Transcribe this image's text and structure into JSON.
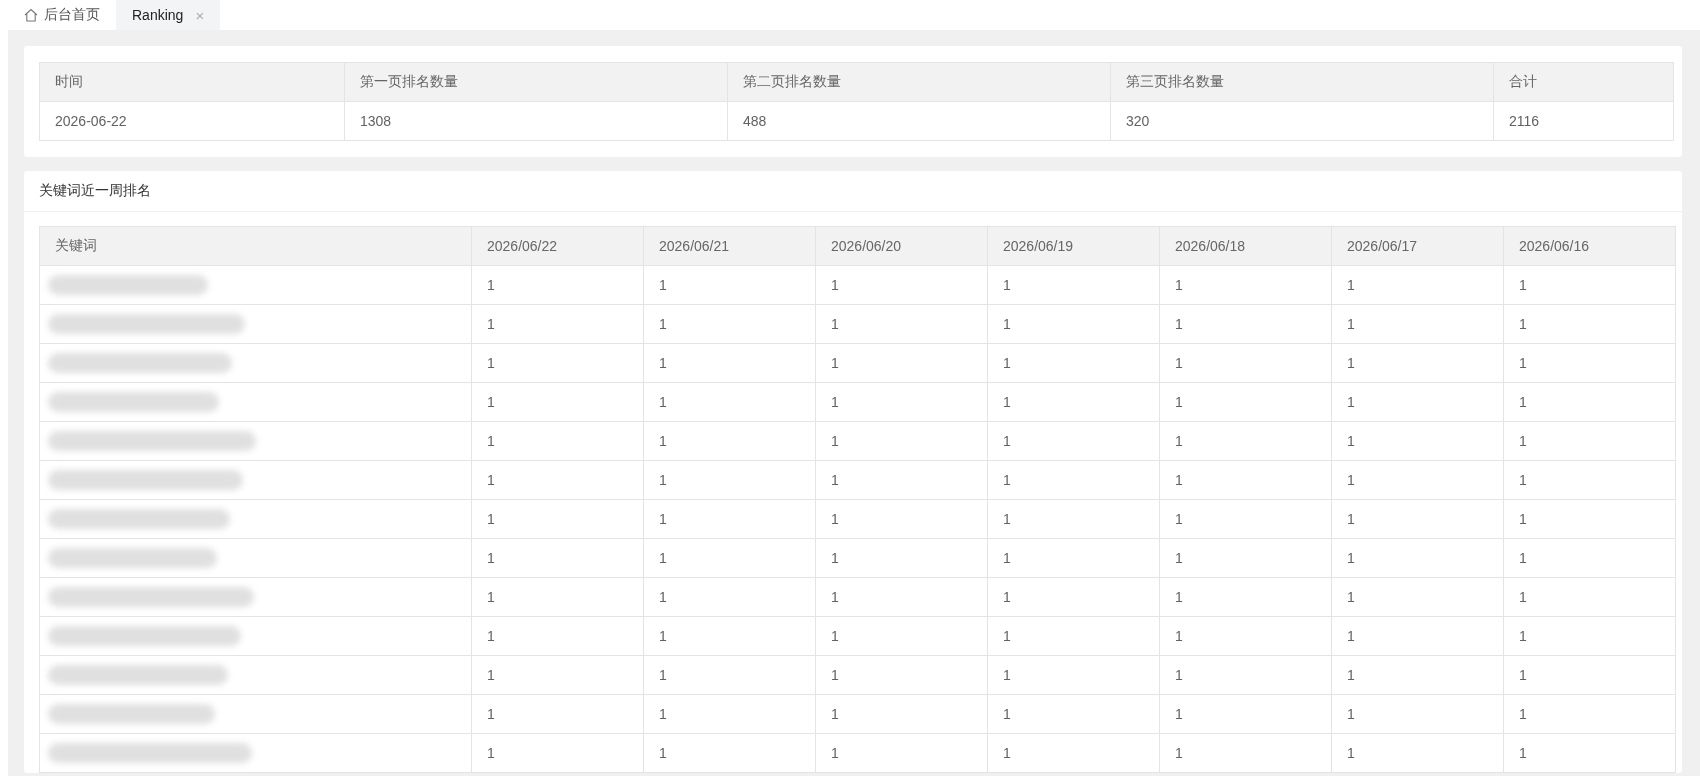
{
  "tabs": [
    {
      "label": "后台首页",
      "kind": "home",
      "selected": false,
      "closable": false
    },
    {
      "label": "Ranking",
      "kind": "page",
      "selected": true,
      "closable": true,
      "close_glyph": "×"
    }
  ],
  "summary": {
    "columns": [
      "时间",
      "第一页排名数量",
      "第二页排名数量",
      "第三页排名数量",
      "合计"
    ],
    "rows": [
      [
        "2026-06-22",
        "1308",
        "488",
        "320",
        "2116"
      ]
    ]
  },
  "weekly": {
    "title": "关键词近一周排名",
    "columns": [
      "关键词",
      "2026/06/22",
      "2026/06/21",
      "2026/06/20",
      "2026/06/19",
      "2026/06/18",
      "2026/06/17",
      "2026/06/16"
    ],
    "rows": [
      {
        "keyword_blurred": true,
        "ranks": [
          "1",
          "1",
          "1",
          "1",
          "1",
          "1",
          "1"
        ]
      },
      {
        "keyword_blurred": true,
        "ranks": [
          "1",
          "1",
          "1",
          "1",
          "1",
          "1",
          "1"
        ]
      },
      {
        "keyword_blurred": true,
        "ranks": [
          "1",
          "1",
          "1",
          "1",
          "1",
          "1",
          "1"
        ]
      },
      {
        "keyword_blurred": true,
        "ranks": [
          "1",
          "1",
          "1",
          "1",
          "1",
          "1",
          "1"
        ]
      },
      {
        "keyword_blurred": true,
        "ranks": [
          "1",
          "1",
          "1",
          "1",
          "1",
          "1",
          "1"
        ]
      },
      {
        "keyword_blurred": true,
        "ranks": [
          "1",
          "1",
          "1",
          "1",
          "1",
          "1",
          "1"
        ]
      },
      {
        "keyword_blurred": true,
        "ranks": [
          "1",
          "1",
          "1",
          "1",
          "1",
          "1",
          "1"
        ]
      },
      {
        "keyword_blurred": true,
        "ranks": [
          "1",
          "1",
          "1",
          "1",
          "1",
          "1",
          "1"
        ]
      },
      {
        "keyword_blurred": true,
        "ranks": [
          "1",
          "1",
          "1",
          "1",
          "1",
          "1",
          "1"
        ]
      },
      {
        "keyword_blurred": true,
        "ranks": [
          "1",
          "1",
          "1",
          "1",
          "1",
          "1",
          "1"
        ]
      },
      {
        "keyword_blurred": true,
        "ranks": [
          "1",
          "1",
          "1",
          "1",
          "1",
          "1",
          "1"
        ]
      },
      {
        "keyword_blurred": true,
        "ranks": [
          "1",
          "1",
          "1",
          "1",
          "1",
          "1",
          "1"
        ]
      },
      {
        "keyword_blurred": true,
        "ranks": [
          "1",
          "1",
          "1",
          "1",
          "1",
          "1",
          "1"
        ]
      }
    ]
  }
}
